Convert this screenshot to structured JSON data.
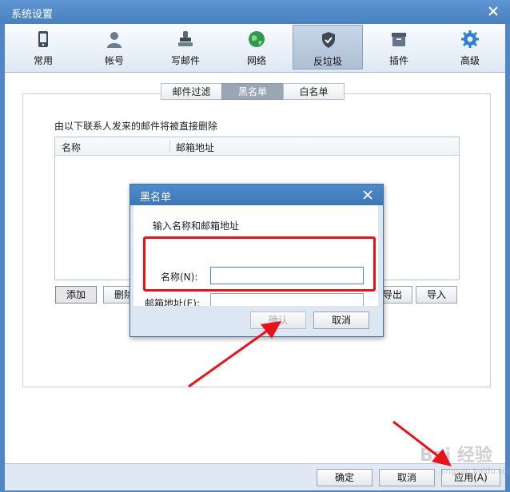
{
  "window": {
    "title": "系统设置"
  },
  "toolbar": {
    "items": [
      {
        "label": "常用",
        "icon": "phone-icon"
      },
      {
        "label": "帐号",
        "icon": "user-icon"
      },
      {
        "label": "写邮件",
        "icon": "stamp-icon"
      },
      {
        "label": "网络",
        "icon": "globe-icon"
      },
      {
        "label": "反垃圾",
        "icon": "shield-check-icon",
        "active": true
      },
      {
        "label": "插件",
        "icon": "box-icon"
      },
      {
        "label": "高级",
        "icon": "gear-icon"
      }
    ]
  },
  "tabs": [
    "邮件过滤",
    "黑名单",
    "白名单"
  ],
  "selected_tab": "黑名单",
  "description": "由以下联系人发来的邮件将被直接删除",
  "list": {
    "columns": [
      "名称",
      "邮箱地址"
    ],
    "rows": []
  },
  "list_buttons": {
    "add": "添加",
    "delete": "删除",
    "export": "导出",
    "import": "导入"
  },
  "dialog": {
    "title": "黑名单",
    "hint": "输入名称和邮箱地址",
    "name_label": "名称(N):",
    "email_label": "邮箱地址(E):",
    "name_value": "",
    "email_value": "",
    "ok": "确认",
    "cancel": "取消"
  },
  "footer": {
    "ok": "确定",
    "cancel": "取消",
    "apply": "应用(A)"
  },
  "watermark": {
    "text": "Bai 经验",
    "sub": "jingyan.baidu.com"
  },
  "colors": {
    "title_bar": "#4a80be",
    "highlight": "#e8121a",
    "selected_tab": "#9aa6b4"
  }
}
